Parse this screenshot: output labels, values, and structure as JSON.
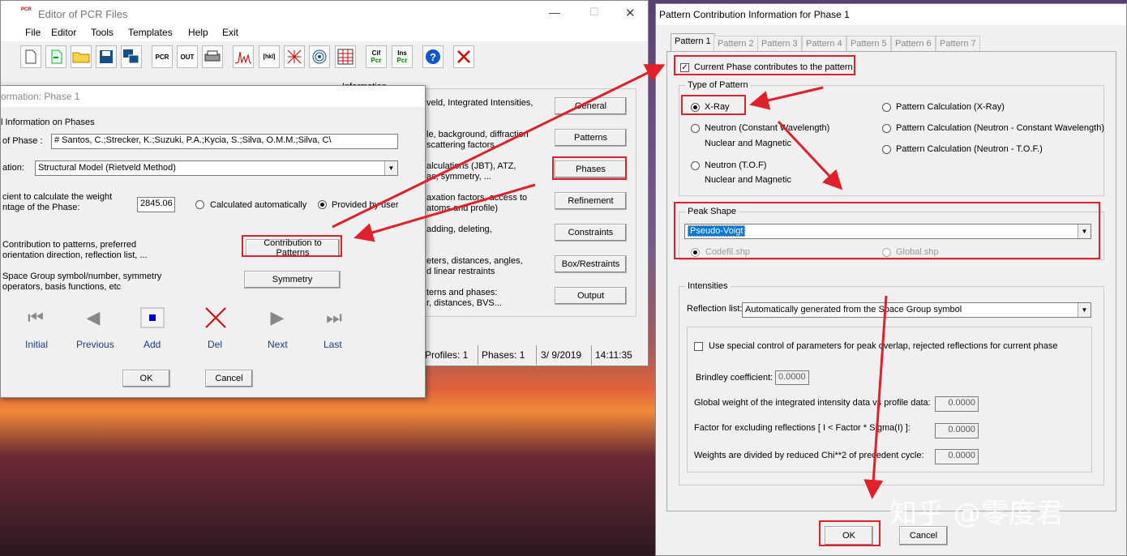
{
  "pcr_editor": {
    "title": "Editor of PCR Files",
    "logo": "PCR",
    "menu": [
      "File",
      "Editor",
      "Tools",
      "Templates",
      "Help",
      "Exit"
    ],
    "toolbar_icons": [
      "new-file-icon",
      "import-icon",
      "open-folder-icon",
      "save-icon",
      "multi-window-icon",
      "pcr-icon",
      "out-icon",
      "print-icon",
      "pattern-plot-icon",
      "hkl-icon",
      "grid-icon",
      "fingerprint-icon",
      "table-icon",
      "cif-to-pcr-icon",
      "ins-to-pcr-icon",
      "help-icon",
      "close-icon"
    ],
    "toolbar_texts": {
      "pcr": "PCR",
      "out": "OUT",
      "cif": "Cif",
      "ins": "Ins",
      "pcr_sub": "Pcr"
    },
    "info_title": "Information",
    "info_rows": [
      {
        "text1": "veld, Integrated Intensities,",
        "text2": "",
        "button": "General"
      },
      {
        "text1": "le, background, diffraction",
        "text2": "scattering factors",
        "button": "Patterns"
      },
      {
        "text1": "alculations (JBT), ATZ,",
        "text2": "as, symmetry, ...",
        "button": "Phases"
      },
      {
        "text1": "axation factors, access to",
        "text2": "atoms and profile)",
        "button": "Refinement"
      },
      {
        "text1": "adding, deleting,",
        "text2": "",
        "button": "Constraints"
      },
      {
        "text1": "eters, distances, angles,",
        "text2": "d linear restraints",
        "button": "Box/Restraints"
      },
      {
        "text1": "terns and phases:",
        "text2": "r, distances, BVS...",
        "button": "Output"
      }
    ],
    "status": {
      "profiles": "Profiles:  1",
      "phases": "Phases:  1",
      "date": "3/ 9/2019",
      "time": "14:11:35"
    }
  },
  "phase_dialog": {
    "title": "ormation: Phase 1",
    "section": "l Information on Phases",
    "name_label": "of Phase :",
    "name_value": "# Santos, C.;Strecker, K.;Suzuki, P.A.;Kycia, S.;Silva, O.M.M.;Silva, C\\",
    "calc_label": "ation:",
    "calc_value": "Structural Model (Rietveld Method)",
    "weight_label1": "cient to calculate the weight",
    "weight_label2": "ntage of the Phase:",
    "weight_value": "2845.06",
    "calc_auto": "Calculated automatically",
    "provided": "Provided by user",
    "contrib_label1": "Contribution to patterns, preferred",
    "contrib_label2": "orientation direction, reflection list, ...",
    "contrib_button": "Contribution to Patterns",
    "sym_label1": "Space Group symbol/number, symmetry",
    "sym_label2": "operators, basis functions, etc",
    "sym_button": "Symmetry",
    "nav": [
      "Initial",
      "Previous",
      "Add",
      "Del",
      "Next",
      "Last"
    ],
    "ok": "OK",
    "cancel": "Cancel"
  },
  "pattern_dialog": {
    "title": "Pattern Contribution Information for Phase    1",
    "tabs": [
      "Pattern 1",
      "Pattern 2",
      "Pattern 3",
      "Pattern 4",
      "Pattern 5",
      "Pattern 6",
      "Pattern 7"
    ],
    "contributes": "Current Phase contributes to the pattern",
    "type_group": "Type of Pattern",
    "xray": "X-Ray",
    "neutron_cw": "Neutron (Constant Wavelength)",
    "nuclear_magnetic": "Nuclear and Magnetic",
    "neutron_tof": "Neutron (T.O.F)",
    "calc_xray": "Pattern Calculation (X-Ray)",
    "calc_ncw": "Pattern Calculation (Neutron - Constant Wavelength)",
    "calc_ntof": "Pattern Calculation (Neutron - T.O.F.)",
    "peak_group": "Peak Shape",
    "peak_value": "Pseudo-Voigt",
    "codefil": "Codefil.shp",
    "global_shp": "Global.shp",
    "int_group": "Intensities",
    "refl_label": "Reflection list:",
    "refl_value": "Automatically generated from the Space Group symbol",
    "special": "Use special control of parameters for peak overlap, rejected reflections for current phase",
    "brindley_label": "Brindley coefficient:",
    "brindley_value": "0.0000",
    "gw_label": "Global weight of the integrated intensity data vs profile data:",
    "gw_value": "0.0000",
    "factor_label": "Factor for excluding reflections [  I < Factor * Sigma(I) ]:",
    "factor_value": "0.0000",
    "weights_label": "Weights are divided by reduced Chi**2 of precedent cycle:",
    "weights_value": "0.0000",
    "ok": "OK",
    "cancel": "Cancel"
  },
  "watermark": "知乎 @零度君",
  "colors": {
    "annotation_red": "#e0202a",
    "link_blue": "#1a3c8a",
    "selection": "#0078d7"
  }
}
